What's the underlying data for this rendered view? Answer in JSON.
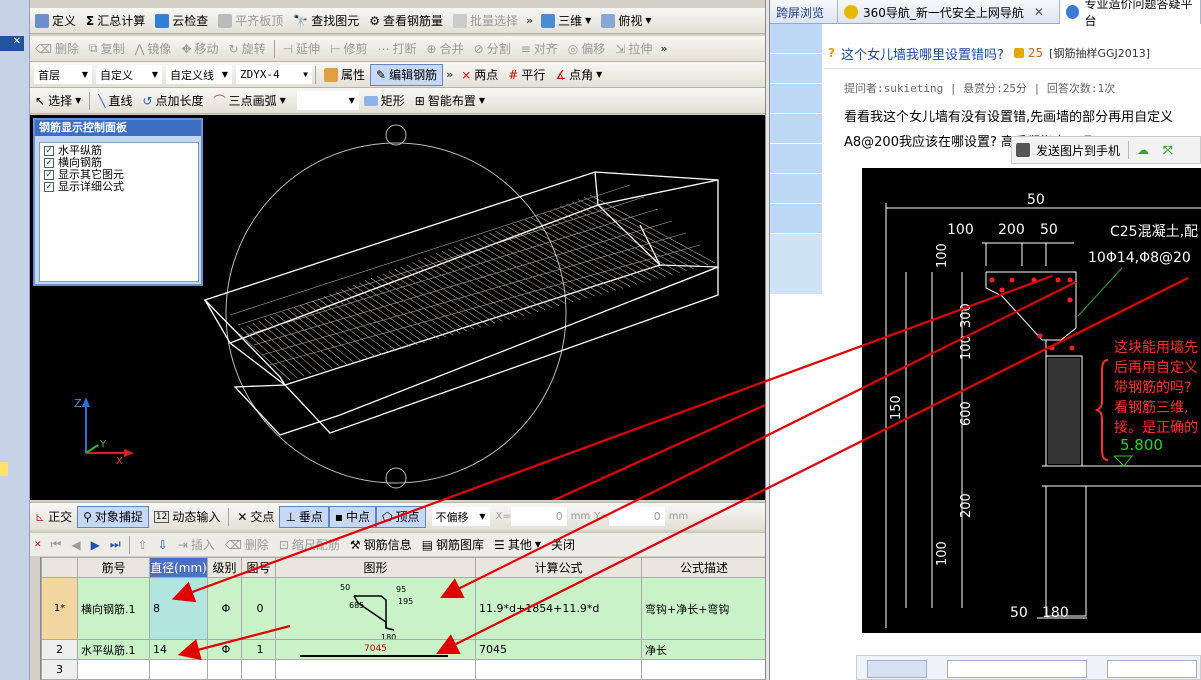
{
  "app": {
    "menu": {
      "items": [
        "定义",
        "汇总计算",
        "云检查",
        "平齐板顶",
        "查找图元",
        "查看钢筋量",
        "批量选择"
      ],
      "view_mode": "三维",
      "view_dir": "俯视"
    },
    "edit_toolbar": [
      "删除",
      "复制",
      "镜像",
      "移动",
      "旋转",
      "延伸",
      "修剪",
      "打断",
      "合并",
      "分割",
      "对齐",
      "偏移",
      "拉伸"
    ],
    "layer_toolbar": {
      "floor": "首层",
      "category": "自定义",
      "element": "自定义线",
      "name": "ZDYX-4",
      "props": "属性",
      "edit_rebar": "编辑钢筋",
      "two_points": "两点",
      "parallel": "平行",
      "point_angle": "点角"
    },
    "draw_toolbar": {
      "select": "选择",
      "line": "直线",
      "arc_point_len": "点加长度",
      "three_point_arc": "三点画弧",
      "rect": "矩形",
      "smart": "智能布置"
    },
    "control_panel": {
      "title": "钢筋显示控制面板",
      "items": [
        "水平纵筋",
        "横向钢筋",
        "显示其它图元",
        "显示详细公式"
      ]
    },
    "snap_toolbar": {
      "ortho": "正交",
      "snap": "对象捕捉",
      "dynamic": "动态输入",
      "intersect": "交点",
      "perp": "垂点",
      "mid": "中点",
      "vertex": "顶点",
      "offset": "不偏移",
      "x_label": "X=",
      "x_val": "0",
      "y_label": "Y=",
      "y_val": "0",
      "unit": "mm"
    },
    "rebar_toolbar": {
      "insert": "插入",
      "delete": "删除",
      "scale": "缩尺配筋",
      "info": "钢筋信息",
      "library": "钢筋图库",
      "other": "其他",
      "close": "关闭"
    },
    "axis": {
      "z": "Z",
      "y": "Y",
      "x": "X"
    },
    "table": {
      "headers": [
        "",
        "筋号",
        "直径(mm)",
        "级别",
        "图号",
        "图形",
        "计算公式",
        "公式描述"
      ],
      "rows": [
        {
          "idx": "1*",
          "name": "横向钢筋.1",
          "dia": "8",
          "grade": "Φ",
          "fig": "0",
          "formula": "11.9*d+1854+11.9*d",
          "desc": "弯钩+净长+弯钩",
          "shape_labels": [
            "50",
            "95",
            "685",
            "180",
            "195"
          ]
        },
        {
          "idx": "2",
          "name": "水平纵筋.1",
          "dia": "14",
          "grade": "Φ",
          "fig": "1",
          "formula": "7045",
          "desc": "净长",
          "shape_labels": [
            "7045"
          ]
        },
        {
          "idx": "3",
          "name": "",
          "dia": "",
          "grade": "",
          "fig": "",
          "formula": "",
          "desc": "",
          "shape_labels": []
        }
      ]
    }
  },
  "browser": {
    "tabs": [
      "跨屏浏览",
      "360导航_新一代安全上网导航",
      "专业造价问题答疑平台"
    ],
    "question_title": "这个女儿墙我哪里设置错吗?",
    "points": "25",
    "category": "[钢筋抽样GGJ2013]",
    "meta": "提问者:sukieting  |  悬赏分:25分  |  回答次数:1次",
    "body_line1": "看看我这个女儿墙有没有设置错,先画墙的部分再用自定义",
    "body_line2": "A8@200我应该在哪设置? 高手们指点下吧",
    "send_to_phone": "发送图片到手机",
    "cad": {
      "dims": [
        "50",
        "100",
        "200",
        "50",
        "100",
        "300",
        "100",
        "600",
        "150",
        "200",
        "100",
        "50",
        "180"
      ],
      "concrete_note": "C25混凝土,配",
      "rebar_note": "10Φ14,Φ8@20",
      "level": "5.800",
      "red_note": [
        "这块能用墙先",
        "后再用自定义",
        "带钢筋的吗?",
        "看钢筋三维,",
        "接。是正确的"
      ]
    }
  },
  "colors": {
    "accent": "#3c6fc3",
    "grid_green": "#c9f2c9",
    "annotation_red": "#e00000",
    "cad_bg": "#000000"
  }
}
